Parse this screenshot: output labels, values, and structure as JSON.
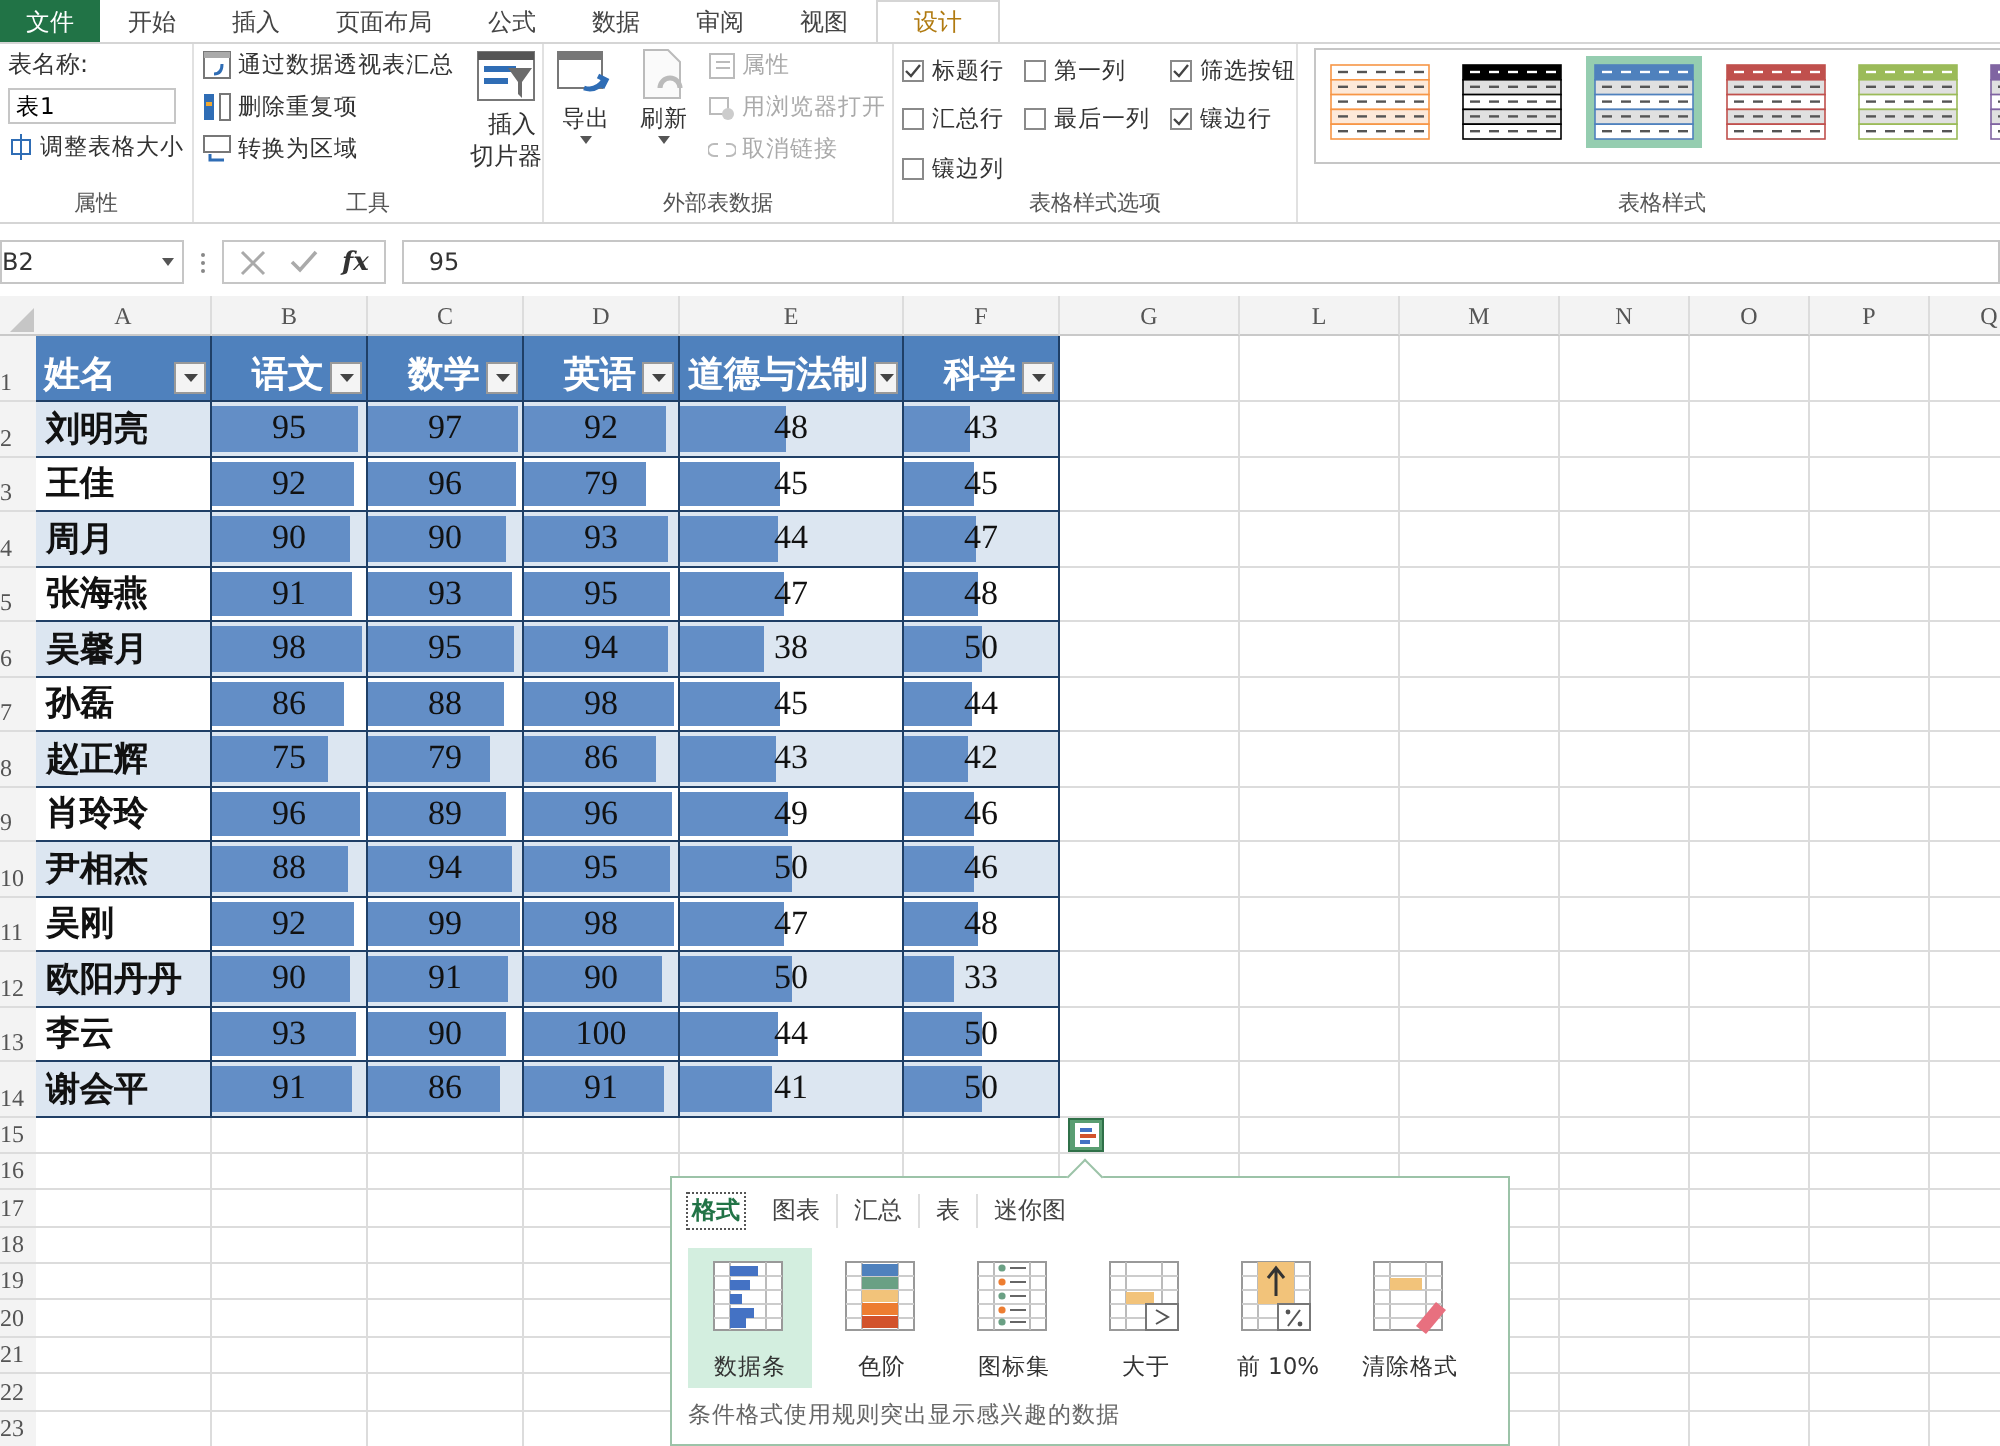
{
  "ribbon_tabs": [
    {
      "label": "文件",
      "kind": "file",
      "selected": false
    },
    {
      "label": "开始",
      "kind": "tab",
      "selected": false
    },
    {
      "label": "插入",
      "kind": "tab",
      "selected": false
    },
    {
      "label": "页面布局",
      "kind": "tab",
      "selected": false
    },
    {
      "label": "公式",
      "kind": "tab",
      "selected": false
    },
    {
      "label": "数据",
      "kind": "tab",
      "selected": false
    },
    {
      "label": "审阅",
      "kind": "tab",
      "selected": false
    },
    {
      "label": "视图",
      "kind": "tab",
      "selected": false
    },
    {
      "label": "设计",
      "kind": "tab",
      "selected": true
    }
  ],
  "ribbon": {
    "properties": {
      "table_name_label": "表名称:",
      "table_name": "表1",
      "resize": "调整表格大小",
      "group_label": "属性"
    },
    "tools": {
      "items": [
        {
          "label": "通过数据透视表汇总",
          "kind": "pivot"
        },
        {
          "label": "删除重复项",
          "kind": "dedupe"
        },
        {
          "label": "转换为区域",
          "kind": "convert"
        }
      ],
      "slicer": "插入切片器",
      "group_label": "工具"
    },
    "external": {
      "export": "导出",
      "refresh": "刷新",
      "items": [
        {
          "label": "属性",
          "kind": "props",
          "disabled": true
        },
        {
          "label": "用浏览器打开",
          "kind": "browser",
          "disabled": true
        },
        {
          "label": "取消链接",
          "kind": "unlink",
          "disabled": true
        }
      ],
      "group_label": "外部表数据"
    },
    "style_options": {
      "options": [
        {
          "label": "标题行",
          "checked": true
        },
        {
          "label": "第一列",
          "checked": false
        },
        {
          "label": "筛选按钮",
          "checked": true
        },
        {
          "label": "汇总行",
          "checked": false
        },
        {
          "label": "最后一列",
          "checked": false
        },
        {
          "label": "镶边行",
          "checked": true
        },
        {
          "label": "镶边列",
          "checked": false
        }
      ],
      "group_label": "表格样式选项"
    },
    "table_styles": {
      "styles": [
        {
          "color": "#f79646",
          "kind": "grid",
          "selected": false
        },
        {
          "color": "#000000",
          "kind": "banded",
          "selected": false
        },
        {
          "color": "#4f81bd",
          "kind": "banded",
          "selected": true
        },
        {
          "color": "#c0504d",
          "kind": "banded",
          "selected": false
        },
        {
          "color": "#9bbb59",
          "kind": "banded",
          "selected": false
        },
        {
          "color": "#8064a2",
          "kind": "banded",
          "selected": false
        }
      ],
      "group_label": "表格样式"
    }
  },
  "formula_bar": {
    "name_box": "B2",
    "function_label": "fx",
    "value": "95"
  },
  "column_headers": [
    "A",
    "B",
    "C",
    "D",
    "E",
    "F",
    "G",
    "L",
    "M",
    "N",
    "O",
    "P",
    "Q"
  ],
  "row_numbers": [
    "1",
    "2",
    "3",
    "4",
    "5",
    "6",
    "7",
    "8",
    "9",
    "10",
    "11",
    "12",
    "13",
    "14",
    "15",
    "16",
    "17",
    "18",
    "19",
    "20",
    "21",
    "22",
    "23"
  ],
  "table": {
    "columns": [
      "姓名",
      "语文",
      "数学",
      "英语",
      "道德与法制",
      "科学"
    ],
    "rows": [
      {
        "name": "刘明亮",
        "scores": [
          {
            "text": "95",
            "level": 0.95
          },
          {
            "text": "97",
            "level": 0.97
          },
          {
            "text": "92",
            "level": 0.92
          },
          {
            "text": "48",
            "level": 0.48
          },
          {
            "text": "43",
            "level": 0.43
          }
        ]
      },
      {
        "name": "王佳",
        "scores": [
          {
            "text": "92",
            "level": 0.92
          },
          {
            "text": "96",
            "level": 0.96
          },
          {
            "text": "79",
            "level": 0.79
          },
          {
            "text": "45",
            "level": 0.45
          },
          {
            "text": "45",
            "level": 0.45
          }
        ]
      },
      {
        "name": "周月",
        "scores": [
          {
            "text": "90",
            "level": 0.9
          },
          {
            "text": "90",
            "level": 0.9
          },
          {
            "text": "93",
            "level": 0.93
          },
          {
            "text": "44",
            "level": 0.44
          },
          {
            "text": "47",
            "level": 0.47
          }
        ]
      },
      {
        "name": "张海燕",
        "scores": [
          {
            "text": "91",
            "level": 0.91
          },
          {
            "text": "93",
            "level": 0.93
          },
          {
            "text": "95",
            "level": 0.95
          },
          {
            "text": "47",
            "level": 0.47
          },
          {
            "text": "48",
            "level": 0.48
          }
        ]
      },
      {
        "name": "吴馨月",
        "scores": [
          {
            "text": "98",
            "level": 0.98
          },
          {
            "text": "95",
            "level": 0.95
          },
          {
            "text": "94",
            "level": 0.94
          },
          {
            "text": "38",
            "level": 0.38
          },
          {
            "text": "50",
            "level": 0.5
          }
        ]
      },
      {
        "name": "孙磊",
        "scores": [
          {
            "text": "86",
            "level": 0.86
          },
          {
            "text": "88",
            "level": 0.88
          },
          {
            "text": "98",
            "level": 0.98
          },
          {
            "text": "45",
            "level": 0.45
          },
          {
            "text": "44",
            "level": 0.44
          }
        ]
      },
      {
        "name": "赵正辉",
        "scores": [
          {
            "text": "75",
            "level": 0.75
          },
          {
            "text": "79",
            "level": 0.79
          },
          {
            "text": "86",
            "level": 0.86
          },
          {
            "text": "43",
            "level": 0.43
          },
          {
            "text": "42",
            "level": 0.42
          }
        ]
      },
      {
        "name": "肖玲玲",
        "scores": [
          {
            "text": "96",
            "level": 0.96
          },
          {
            "text": "89",
            "level": 0.89
          },
          {
            "text": "96",
            "level": 0.96
          },
          {
            "text": "49",
            "level": 0.49
          },
          {
            "text": "46",
            "level": 0.46
          }
        ]
      },
      {
        "name": "尹相杰",
        "scores": [
          {
            "text": "88",
            "level": 0.88
          },
          {
            "text": "94",
            "level": 0.94
          },
          {
            "text": "95",
            "level": 0.95
          },
          {
            "text": "50",
            "level": 0.5
          },
          {
            "text": "46",
            "level": 0.46
          }
        ]
      },
      {
        "name": "吴刚",
        "scores": [
          {
            "text": "92",
            "level": 0.92
          },
          {
            "text": "99",
            "level": 0.99
          },
          {
            "text": "98",
            "level": 0.98
          },
          {
            "text": "47",
            "level": 0.47
          },
          {
            "text": "48",
            "level": 0.48
          }
        ]
      },
      {
        "name": "欧阳丹丹",
        "scores": [
          {
            "text": "90",
            "level": 0.9
          },
          {
            "text": "91",
            "level": 0.91
          },
          {
            "text": "90",
            "level": 0.9
          },
          {
            "text": "50",
            "level": 0.5
          },
          {
            "text": "33",
            "level": 0.33
          }
        ]
      },
      {
        "name": "李云",
        "scores": [
          {
            "text": "93",
            "level": 0.93
          },
          {
            "text": "90",
            "level": 0.9
          },
          {
            "text": "100",
            "level": 1.0
          },
          {
            "text": "44",
            "level": 0.44
          },
          {
            "text": "50",
            "level": 0.5
          }
        ]
      },
      {
        "name": "谢会平",
        "scores": [
          {
            "text": "91",
            "level": 0.91
          },
          {
            "text": "86",
            "level": 0.86
          },
          {
            "text": "91",
            "level": 0.91
          },
          {
            "text": "41",
            "level": 0.41
          },
          {
            "text": "50",
            "level": 0.5
          }
        ]
      }
    ]
  },
  "quick_analysis": {
    "tabs": [
      {
        "label": "格式",
        "selected": true
      },
      {
        "label": "图表",
        "selected": false
      },
      {
        "label": "汇总",
        "selected": false
      },
      {
        "label": "表",
        "selected": false
      },
      {
        "label": "迷你图",
        "selected": false
      }
    ],
    "items": [
      {
        "label": "数据条",
        "kind": "databar",
        "selected": true
      },
      {
        "label": "色阶",
        "kind": "colorscale",
        "selected": false
      },
      {
        "label": "图标集",
        "kind": "iconset",
        "selected": false
      },
      {
        "label": "大于",
        "kind": "greater",
        "selected": false
      },
      {
        "label": "前 10%",
        "kind": "top10",
        "selected": false
      },
      {
        "label": "清除格式",
        "kind": "clear",
        "selected": false
      }
    ],
    "description": "条件格式使用规则突出显示感兴趣的数据"
  }
}
